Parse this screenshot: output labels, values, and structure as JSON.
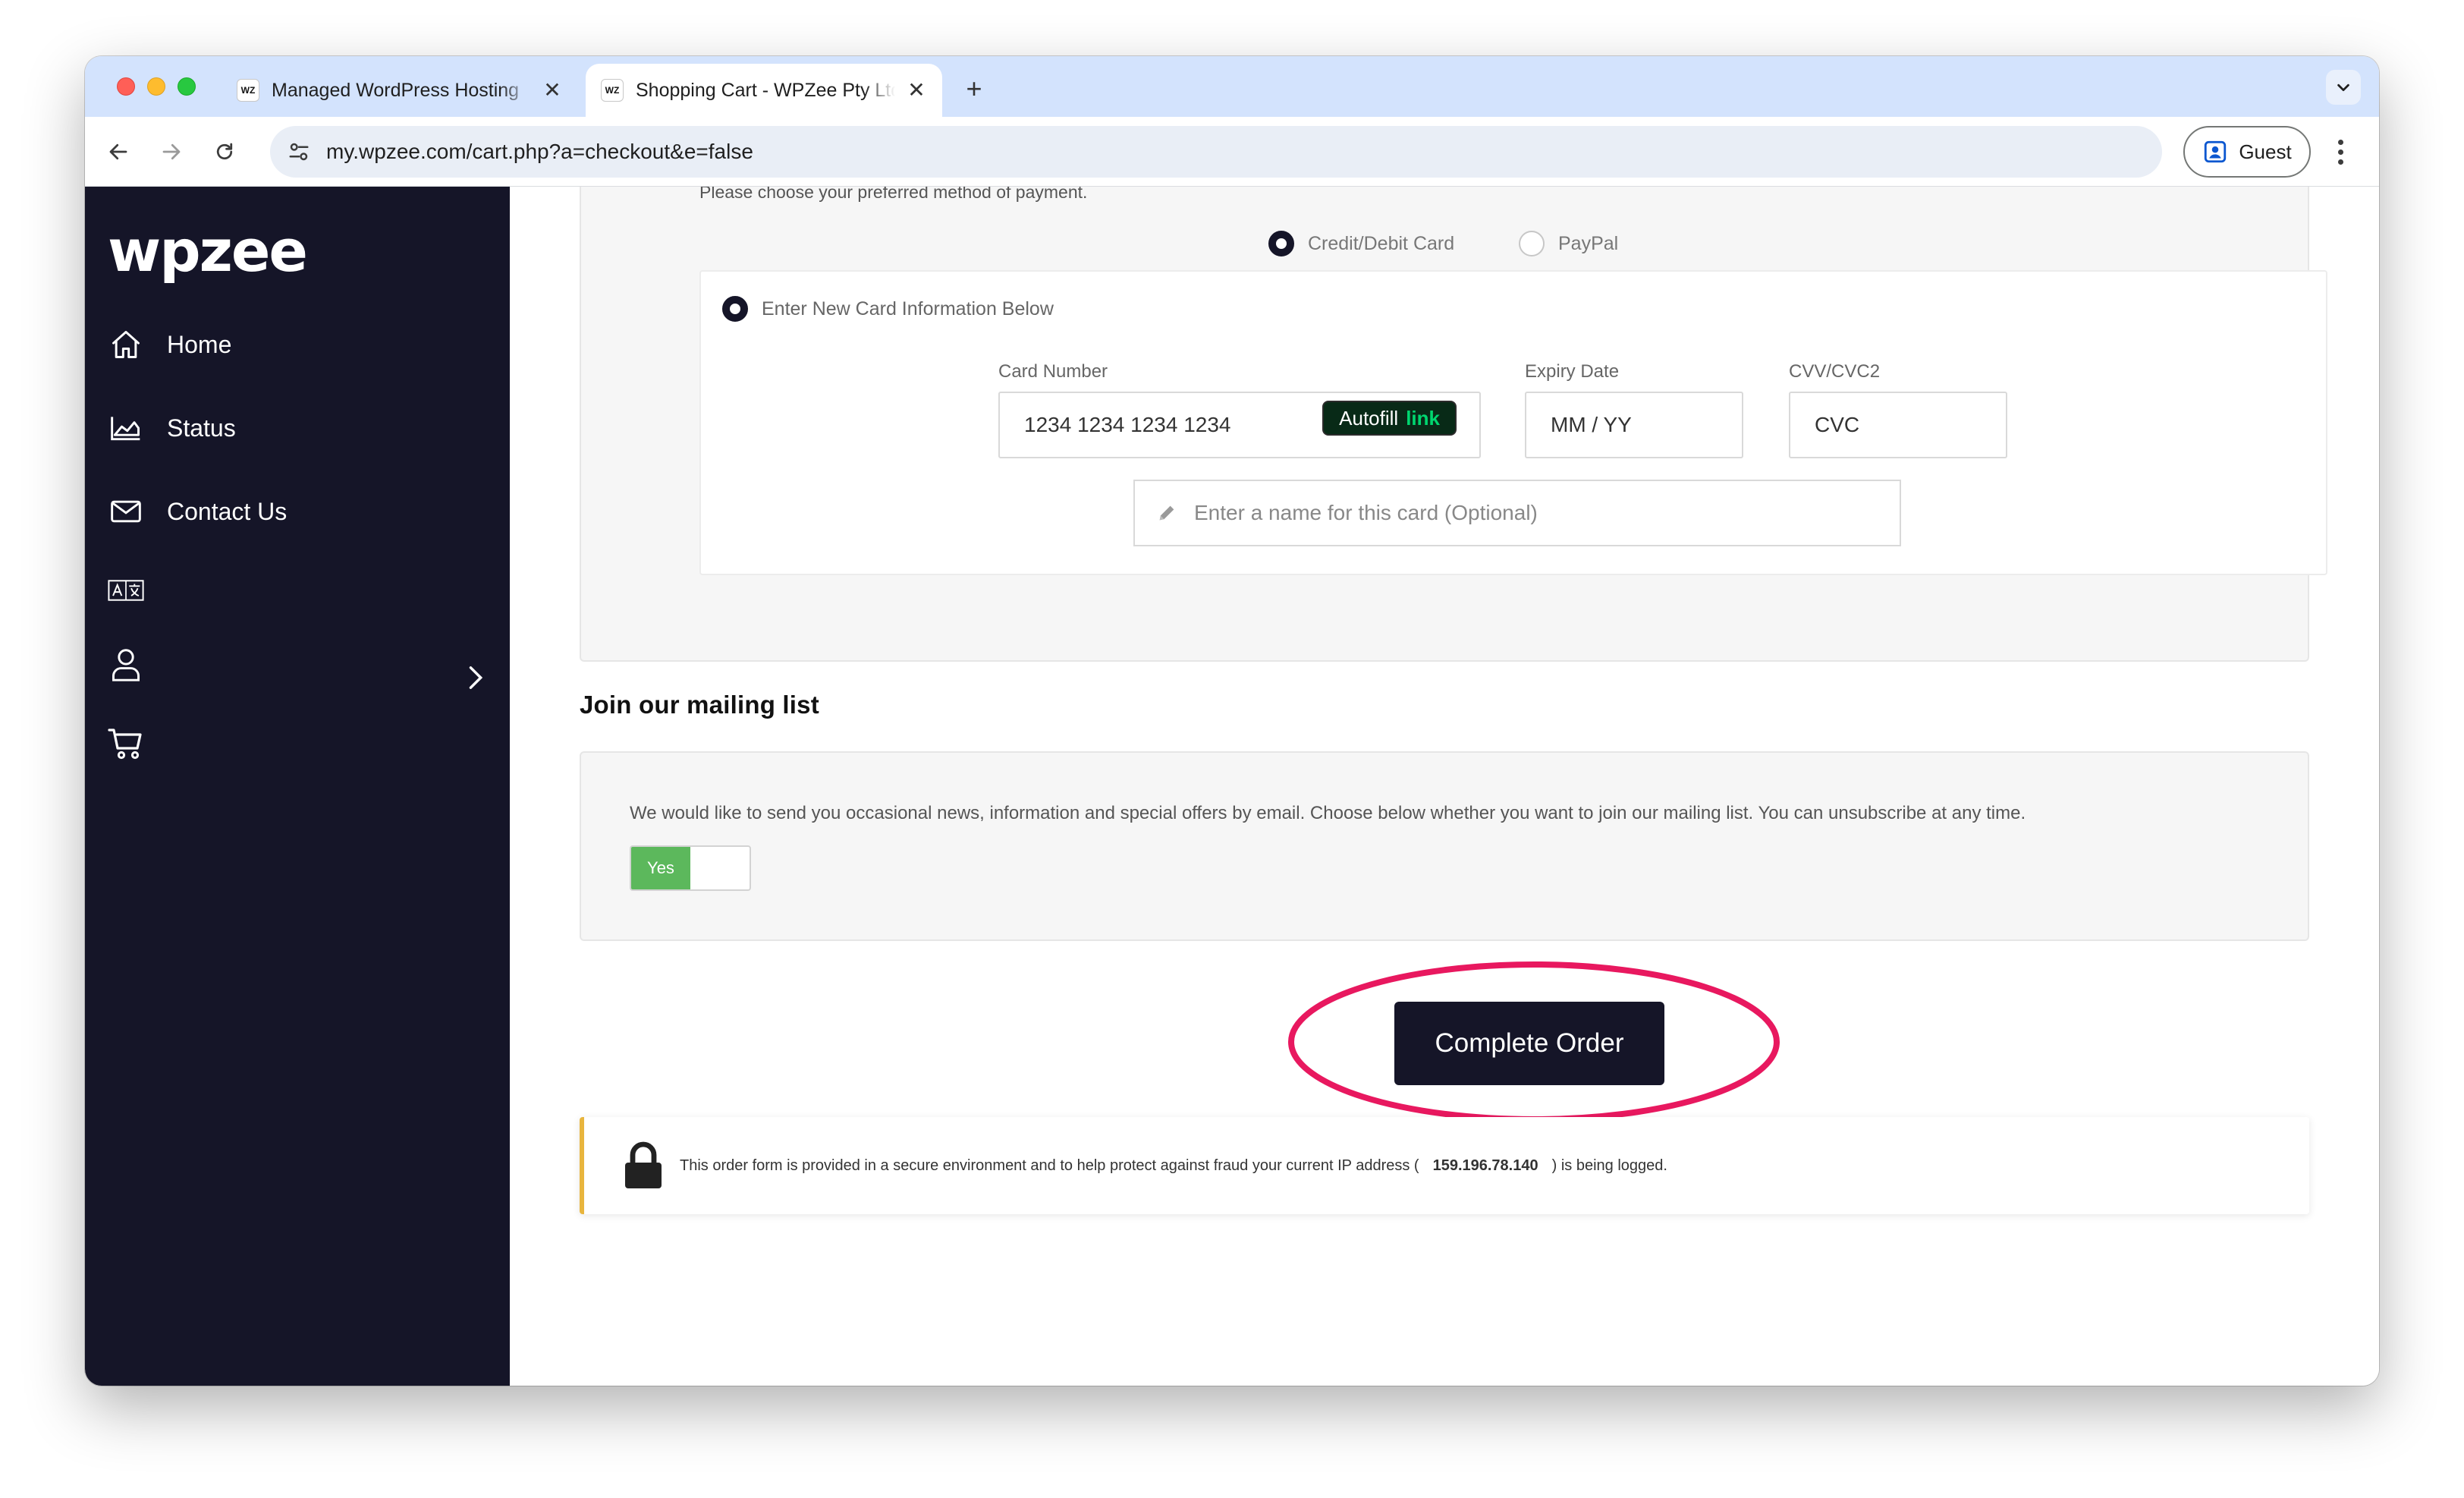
{
  "browser": {
    "tabs": [
      {
        "favicon": "WZ",
        "title": "Managed WordPress Hosting",
        "close": "✕"
      },
      {
        "favicon": "WZ",
        "title": "Shopping Cart - WPZee Pty Ltd",
        "close": "✕"
      }
    ],
    "new_tab": "+",
    "url": "my.wpzee.com/cart.php?a=checkout&e=false",
    "profile_label": "Guest"
  },
  "sidebar": {
    "logo": "wpzee",
    "items": [
      {
        "label": "Home",
        "icon": "home-icon"
      },
      {
        "label": "Status",
        "icon": "chart-icon"
      },
      {
        "label": "Contact Us",
        "icon": "envelope-icon"
      },
      {
        "label": "",
        "icon": "translate-icon"
      },
      {
        "label": "",
        "icon": "user-icon"
      },
      {
        "label": "",
        "icon": "cart-icon"
      }
    ]
  },
  "payment": {
    "instruction": "Please choose your preferred method of payment.",
    "methods": [
      {
        "label": "Credit/Debit Card",
        "selected": true
      },
      {
        "label": "PayPal",
        "selected": false
      }
    ],
    "new_card_label": "Enter New Card Information Below",
    "card_number_label": "Card Number",
    "card_number_placeholder": "1234 1234 1234 1234",
    "autofill_label": "Autofill",
    "autofill_link": "link",
    "expiry_label": "Expiry Date",
    "expiry_placeholder": "MM / YY",
    "cvv_label": "CVV/CVC2",
    "cvv_placeholder": "CVC",
    "card_name_placeholder": "Enter a name for this card (Optional)"
  },
  "mailing": {
    "heading": "Join our mailing list",
    "text": "We would like to send you occasional news, information and special offers by email. Choose below whether you want to join our mailing list. You can unsubscribe at any time.",
    "toggle_label": "Yes"
  },
  "order": {
    "complete_label": "Complete Order"
  },
  "secure_notice": {
    "prefix": "This order form is provided in a secure environment and to help protect against fraud your current IP address (",
    "ip": "159.196.78.140",
    "suffix": ") is being logged."
  },
  "colors": {
    "sidebar_bg": "#151528",
    "button_bg": "#151528",
    "toggle_on": "#5cb85c",
    "annotation": "#e8185f",
    "secure_accent": "#e8b53d"
  }
}
